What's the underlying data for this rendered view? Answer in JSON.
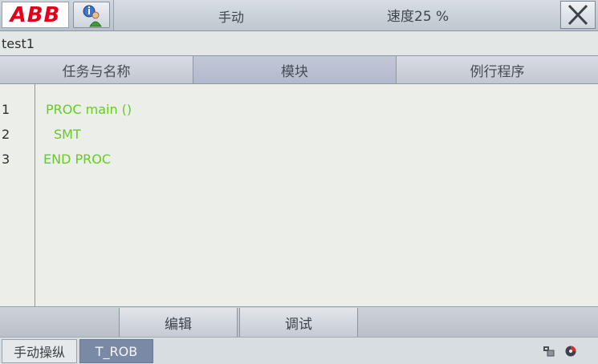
{
  "topbar": {
    "logo_text": "ABB",
    "mode": "手动",
    "speed": "速度25 %",
    "close_icon": "close-icon",
    "info_icon": "info-user-icon"
  },
  "program": {
    "name": "test1"
  },
  "tabs": [
    {
      "label": "任务与名称"
    },
    {
      "label": "模块"
    },
    {
      "label": "例行程序"
    }
  ],
  "editor": {
    "lines": [
      {
        "num": "1",
        "code": "PROC main ()"
      },
      {
        "num": "2",
        "code": "SMT"
      },
      {
        "num": "3",
        "code": "END PROC"
      }
    ],
    "code_color": "#66cc22"
  },
  "buttons": {
    "edit": "编辑",
    "debug": "调试"
  },
  "taskbar": {
    "manual": "手动操纵",
    "task": "T_ROB"
  },
  "colors": {
    "brand_red": "#e2001a",
    "active_task": "#7a8aa6"
  }
}
